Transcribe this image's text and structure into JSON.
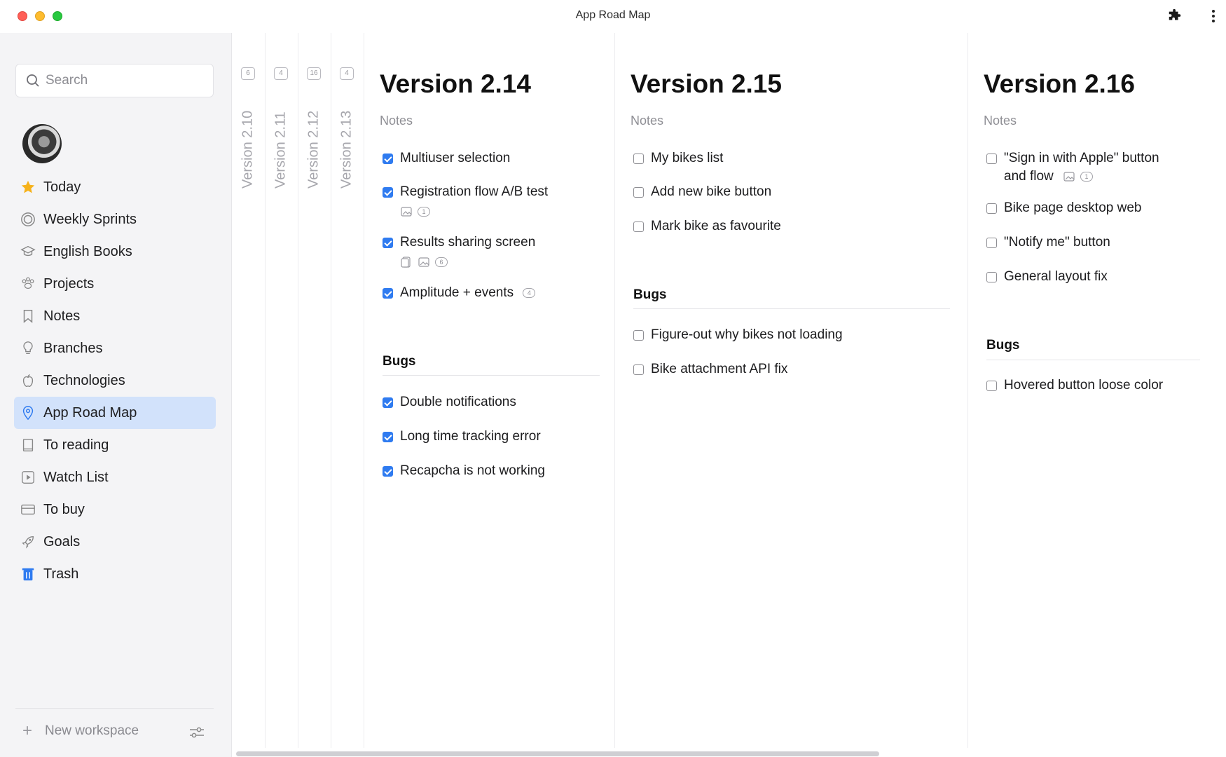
{
  "window": {
    "title": "App Road Map"
  },
  "sidebar": {
    "search_placeholder": "Search",
    "items": [
      {
        "label": "Today",
        "icon": "star-icon"
      },
      {
        "label": "Weekly Sprints",
        "icon": "target-icon"
      },
      {
        "label": "English Books",
        "icon": "graduation-cap-icon"
      },
      {
        "label": "Projects",
        "icon": "paw-icon"
      },
      {
        "label": "Notes",
        "icon": "bookmark-icon"
      },
      {
        "label": "Branches",
        "icon": "lightbulb-icon"
      },
      {
        "label": "Technologies",
        "icon": "apple-icon"
      },
      {
        "label": "App Road Map",
        "icon": "map-pin-icon",
        "active": true
      },
      {
        "label": "To reading",
        "icon": "book-icon"
      },
      {
        "label": "Watch List",
        "icon": "play-icon"
      },
      {
        "label": "To buy",
        "icon": "credit-card-icon"
      },
      {
        "label": "Goals",
        "icon": "rocket-icon"
      },
      {
        "label": "Trash",
        "icon": "trash-icon"
      }
    ],
    "new_workspace": "New workspace"
  },
  "collapsed_columns": [
    {
      "label": "Version 2.10",
      "count": "6"
    },
    {
      "label": "Version 2.11",
      "count": "4"
    },
    {
      "label": "Version 2.12",
      "count": "16"
    },
    {
      "label": "Version 2.13",
      "count": "4"
    }
  ],
  "columns": [
    {
      "title": "Version 2.14",
      "notes": "Notes",
      "tasks": [
        {
          "text": "Multiuser selection",
          "checked": true
        },
        {
          "text": "Registration flow A/B test",
          "checked": true,
          "comments": "1"
        },
        {
          "text": "Results sharing screen",
          "checked": true,
          "comments": "6"
        },
        {
          "text": "Amplitude + events",
          "checked": true,
          "comments": "4"
        }
      ],
      "section": "Bugs",
      "bugs": [
        {
          "text": "Double notifications",
          "checked": true
        },
        {
          "text": "Long time tracking error",
          "checked": true
        },
        {
          "text": "Recapcha is not working",
          "checked": true
        }
      ]
    },
    {
      "title": "Version 2.15",
      "notes": "Notes",
      "tasks": [
        {
          "text": "My bikes list",
          "checked": false
        },
        {
          "text": "Add new bike button",
          "checked": false
        },
        {
          "text": "Mark bike as favourite",
          "checked": false
        }
      ],
      "section": "Bugs",
      "bugs": [
        {
          "text": "Figure-out why bikes not loading",
          "checked": false
        },
        {
          "text": "Bike attachment API fix",
          "checked": false
        }
      ]
    },
    {
      "title": "Version 2.16",
      "notes": "Notes",
      "tasks": [
        {
          "text": "\"Sign in with Apple\" button",
          "text2": "and flow",
          "checked": false,
          "comments": "1"
        },
        {
          "text": "Bike page desktop web",
          "checked": false
        },
        {
          "text": "\"Notify me\" button",
          "checked": false
        },
        {
          "text": "General layout fix",
          "checked": false
        }
      ],
      "section": "Bugs",
      "bugs": [
        {
          "text": "Hovered button loose color",
          "checked": false
        }
      ]
    }
  ],
  "colors": {
    "accent": "#2f7bf0",
    "active_bg": "#d2e2fb",
    "sidebar_bg": "#f4f4f6"
  }
}
